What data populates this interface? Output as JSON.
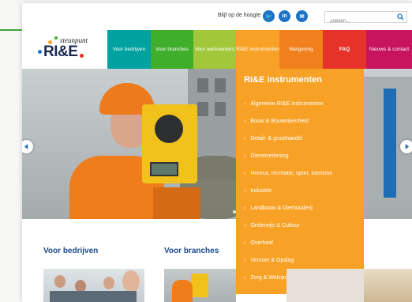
{
  "topbar": {
    "follow_text": "Blijf op de hoogte",
    "social": [
      "twitter-icon",
      "linkedin-icon",
      "mail-icon"
    ],
    "social_glyphs": [
      "🐦",
      "in",
      "✉"
    ],
    "search_placeholder": "Zoeken..."
  },
  "logo": {
    "small_text": "steunpunt",
    "big_text": "RI&E"
  },
  "nav": {
    "items": [
      {
        "label": "Voor bedrijven",
        "color": "#00a2a0"
      },
      {
        "label": "Voor branches",
        "color": "#3fae2a"
      },
      {
        "label": "Voor werknemers",
        "color": "#a2c73b"
      },
      {
        "label": "RI&E instrumenten",
        "color": "#f7a226"
      },
      {
        "label": "Wetgeving",
        "color": "#f07f1e"
      },
      {
        "label": "FAQ",
        "color": "#e5332a"
      },
      {
        "label": "Nieuws & contact",
        "color": "#c8135f"
      }
    ]
  },
  "dropdown": {
    "title": "RI&E instrumenten",
    "items": [
      "Algemene RI&E instrumenten",
      "Bouw & Bouwnijverheid",
      "Detail- & groothandel",
      "Dienstverlening",
      "Horeca, recreatie, sport, toerisme",
      "Industrie",
      "Landbouw & Dierhouderij",
      "Onderwijs & Cultuur",
      "Overheid",
      "Vervoer & Opslag",
      "Zorg & Welzijn"
    ]
  },
  "sections": {
    "bedrijven": "Voor bedrijven",
    "branches": "Voor branches"
  },
  "colors": {
    "accent_blue": "#1a4a8f",
    "dropdown_orange": "#f7a226"
  }
}
